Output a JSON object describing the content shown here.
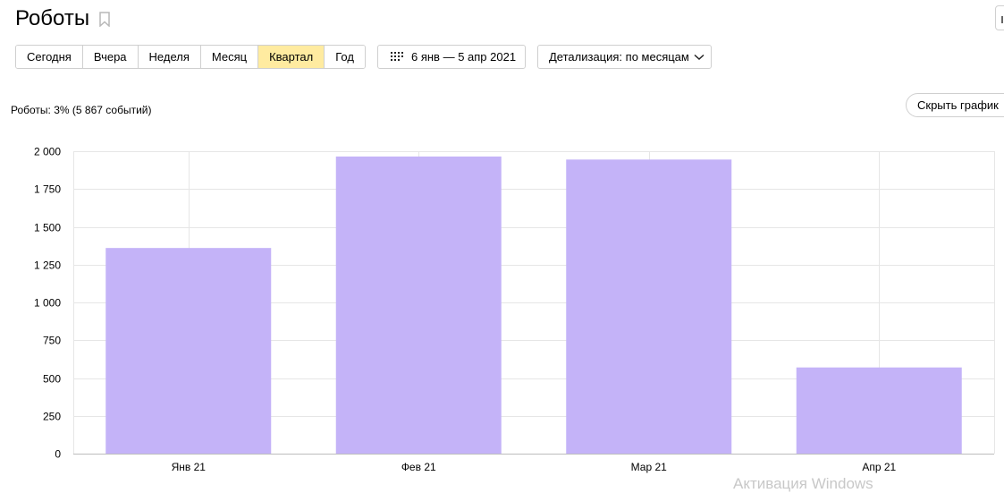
{
  "header": {
    "title": "Роботы"
  },
  "toolbar": {
    "periods": [
      {
        "label": "Сегодня",
        "active": false
      },
      {
        "label": "Вчера",
        "active": false
      },
      {
        "label": "Неделя",
        "active": false
      },
      {
        "label": "Месяц",
        "active": false
      },
      {
        "label": "Квартал",
        "active": true
      },
      {
        "label": "Год",
        "active": false
      }
    ],
    "date_range": "6 янв — 5 апр 2021",
    "detail": "Детализация: по месяцам"
  },
  "summary": "Роботы: 3% (5 867 событий)",
  "hide_chart_label": "Скрыть график",
  "watermark": "Активация Windows",
  "colors": {
    "bar": "#c4b3f8",
    "active_period": "#ffeba0",
    "grid": "#e6e6e6"
  },
  "chart_data": {
    "type": "bar",
    "categories": [
      "Янв 21",
      "Фев 21",
      "Мар 21",
      "Апр 21"
    ],
    "values": [
      1360,
      1965,
      1945,
      570
    ],
    "ylim": [
      0,
      2000
    ],
    "yticks": [
      0,
      250,
      500,
      750,
      1000,
      1250,
      1500,
      1750,
      2000
    ],
    "ytick_labels": [
      "0",
      "250",
      "500",
      "750",
      "1 000",
      "1 250",
      "1 500",
      "1 750",
      "2 000"
    ],
    "grid": true,
    "title": "",
    "xlabel": "",
    "ylabel": ""
  }
}
